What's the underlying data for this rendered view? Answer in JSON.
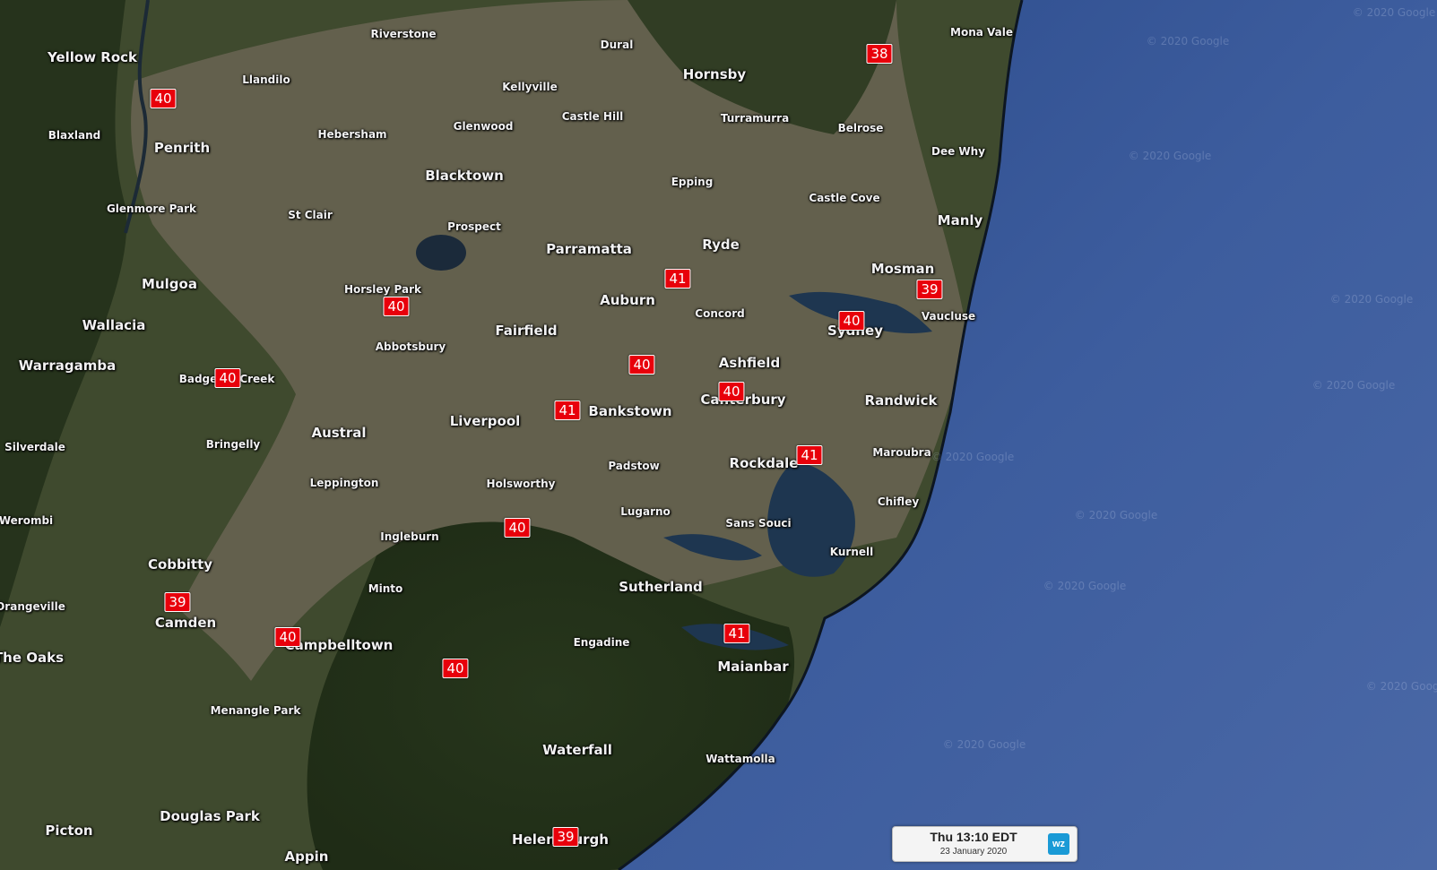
{
  "places": [
    {
      "name": "Yellow Rock",
      "size": "big"
    },
    {
      "name": "Riverstone",
      "size": "small"
    },
    {
      "name": "Dural",
      "size": "small"
    },
    {
      "name": "Mona Vale",
      "size": "small"
    },
    {
      "name": "Llandilo",
      "size": "small"
    },
    {
      "name": "Kellyville",
      "size": "small"
    },
    {
      "name": "Hornsby",
      "size": "big"
    },
    {
      "name": "Castle Hill",
      "size": "small"
    },
    {
      "name": "Turramurra",
      "size": "small"
    },
    {
      "name": "Glenwood",
      "size": "small"
    },
    {
      "name": "Belrose",
      "size": "small"
    },
    {
      "name": "Blaxland",
      "size": "small"
    },
    {
      "name": "Hebersham",
      "size": "small"
    },
    {
      "name": "Penrith",
      "size": "big"
    },
    {
      "name": "Dee Why",
      "size": "small"
    },
    {
      "name": "Blacktown",
      "size": "big"
    },
    {
      "name": "Epping",
      "size": "small"
    },
    {
      "name": "Castle Cove",
      "size": "small"
    },
    {
      "name": "Glenmore Park",
      "size": "small"
    },
    {
      "name": "St Clair",
      "size": "small"
    },
    {
      "name": "Manly",
      "size": "big"
    },
    {
      "name": "Prospect",
      "size": "small"
    },
    {
      "name": "Ryde",
      "size": "big"
    },
    {
      "name": "Parramatta",
      "size": "big"
    },
    {
      "name": "Mosman",
      "size": "big"
    },
    {
      "name": "Mulgoa",
      "size": "big"
    },
    {
      "name": "Horsley Park",
      "size": "small"
    },
    {
      "name": "Auburn",
      "size": "big"
    },
    {
      "name": "Concord",
      "size": "small"
    },
    {
      "name": "Vaucluse",
      "size": "small"
    },
    {
      "name": "Wallacia",
      "size": "big"
    },
    {
      "name": "Fairfield",
      "size": "big"
    },
    {
      "name": "Sydney",
      "size": "big"
    },
    {
      "name": "Abbotsbury",
      "size": "small"
    },
    {
      "name": "Ashfield",
      "size": "big"
    },
    {
      "name": "Warragamba",
      "size": "big"
    },
    {
      "name": "Badgerys Creek",
      "size": "small"
    },
    {
      "name": "Canterbury",
      "size": "big"
    },
    {
      "name": "Randwick",
      "size": "big"
    },
    {
      "name": "Bankstown",
      "size": "big"
    },
    {
      "name": "Liverpool",
      "size": "big"
    },
    {
      "name": "Austral",
      "size": "big"
    },
    {
      "name": "Silverdale",
      "size": "small"
    },
    {
      "name": "Bringelly",
      "size": "small"
    },
    {
      "name": "Maroubra",
      "size": "small"
    },
    {
      "name": "Padstow",
      "size": "small"
    },
    {
      "name": "Rockdale",
      "size": "big"
    },
    {
      "name": "Leppington",
      "size": "small"
    },
    {
      "name": "Holsworthy",
      "size": "small"
    },
    {
      "name": "Chifley",
      "size": "small"
    },
    {
      "name": "Lugarno",
      "size": "small"
    },
    {
      "name": "Werombi",
      "size": "small"
    },
    {
      "name": "Sans Souci",
      "size": "small"
    },
    {
      "name": "Ingleburn",
      "size": "small"
    },
    {
      "name": "Kurnell",
      "size": "small"
    },
    {
      "name": "Cobbitty",
      "size": "big"
    },
    {
      "name": "Sutherland",
      "size": "big"
    },
    {
      "name": "Minto",
      "size": "small"
    },
    {
      "name": "Orangeville",
      "size": "small"
    },
    {
      "name": "Camden",
      "size": "big"
    },
    {
      "name": "Engadine",
      "size": "small"
    },
    {
      "name": "Campbelltown",
      "size": "big"
    },
    {
      "name": "The Oaks",
      "size": "big"
    },
    {
      "name": "Maianbar",
      "size": "big"
    },
    {
      "name": "Menangle Park",
      "size": "small"
    },
    {
      "name": "Waterfall",
      "size": "big"
    },
    {
      "name": "Wattamolla",
      "size": "small"
    },
    {
      "name": "Douglas Park",
      "size": "big"
    },
    {
      "name": "Picton",
      "size": "big"
    },
    {
      "name": "Helensburgh",
      "size": "big"
    },
    {
      "name": "Appin",
      "size": "big"
    }
  ],
  "temperatures": [
    "38",
    "40",
    "40",
    "41",
    "39",
    "40",
    "40",
    "40",
    "40",
    "41",
    "41",
    "40",
    "39",
    "40",
    "41",
    "40",
    "39"
  ],
  "watermark": "© 2020 Google",
  "timebox": {
    "time": "Thu 13:10 EDT",
    "date": "23 January 2020",
    "logo": "wz"
  },
  "colors": {
    "land": "#3e4a2c",
    "urban": "#6e6858",
    "ocean": "#2f4e8f",
    "marker": "#e8000b"
  }
}
